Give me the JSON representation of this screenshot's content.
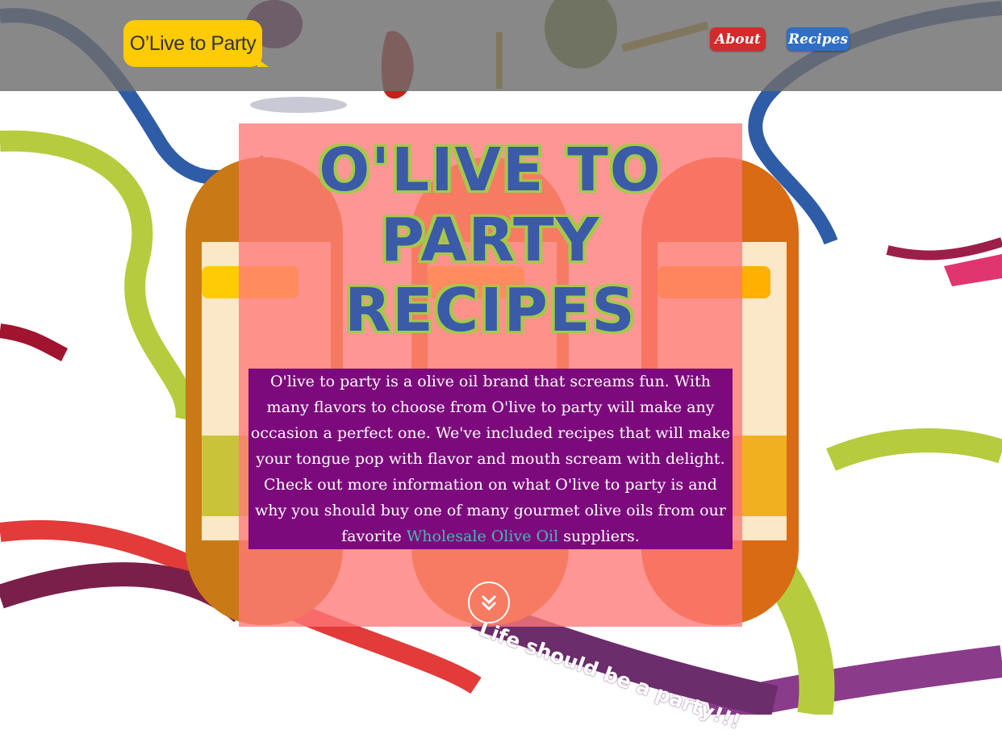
{
  "header": {
    "logo_text": "O’Live to Party",
    "nav": [
      {
        "label": "About"
      },
      {
        "label": "Recipes"
      }
    ]
  },
  "hero": {
    "title_lines": [
      "O'LIVE TO",
      "PARTY",
      "RECIPES"
    ],
    "intro_text": "O'live to party is a olive oil brand that screams fun. With many flavors to choose from O'live to party will make any occasion a perfect one. We've included recipes that will make your tongue pop with flavor and mouth scream with delight. Check out more information on what O'live to party is and why you should buy one of many gourmet olive oils from our favorite ",
    "intro_link": "Wholesale Olive Oil",
    "intro_tail": " suppliers.",
    "ribbon_text": "Life should be a party!!!"
  },
  "colors": {
    "logo_bg": "#ffcb05",
    "about_btn": "#d42a2a",
    "recipes_btn": "#2f6fc4",
    "intro_bg": "#7d0a7d",
    "title_fill": "#3b5aa8",
    "title_outline": "#a6c84a",
    "link": "#46b9b0"
  },
  "icons": {
    "scroll_down": "double-chevron-down-icon"
  }
}
